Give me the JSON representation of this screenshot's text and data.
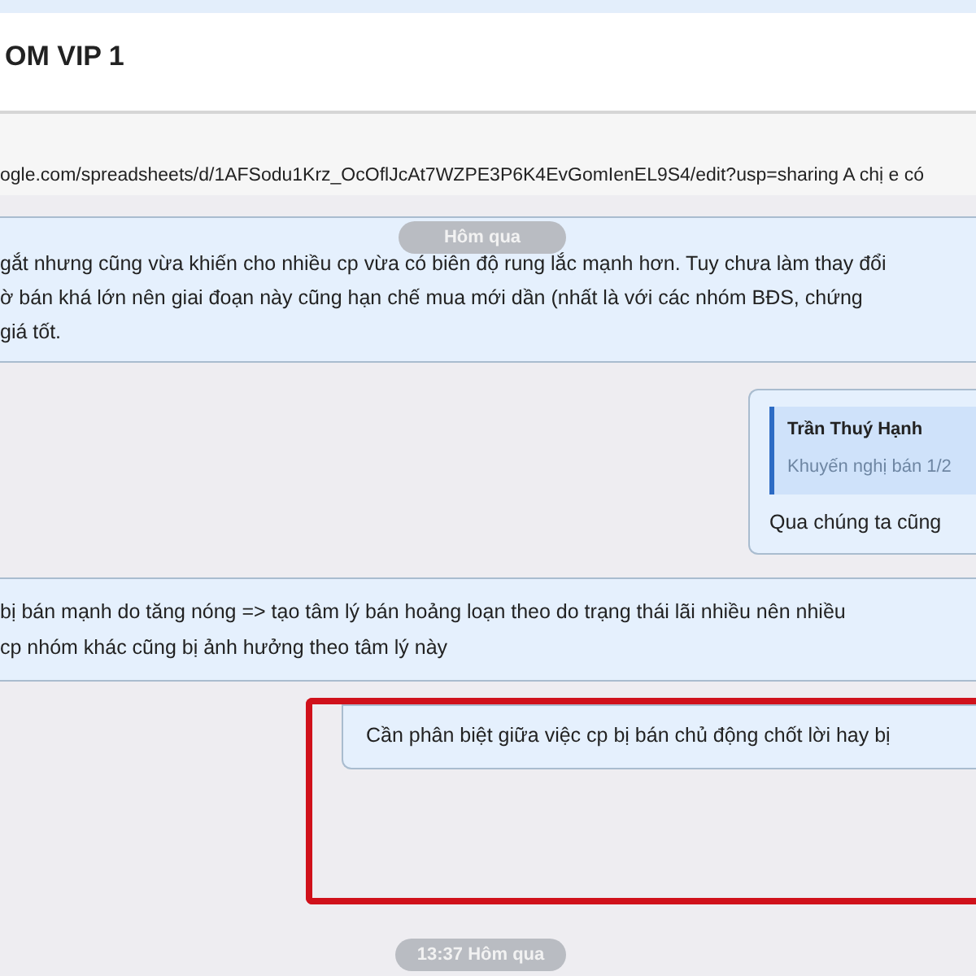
{
  "header": {
    "title": "OM VIP 1"
  },
  "shared_link": "ogle.com/spreadsheets/d/1AFSodu1Krz_OcOflJcAt7WZPE3P6K4EvGomIenEL9S4/edit?usp=sharing A chị e có",
  "messages": [
    {
      "kind": "text",
      "lines": [
        "gắt nhưng cũng vừa khiến cho nhiều cp vừa có biên độ rung lắc mạnh hơn. Tuy chưa làm thay đổi",
        "ờ bán khá lớn nên giai đoạn này cũng hạn chế mua mới dần (nhất là với các nhóm BĐS, chứng",
        "giá tốt."
      ]
    },
    {
      "kind": "reply",
      "quote_author": "Trần Thuý Hạnh",
      "quote_text": "Khuyến nghị bán 1/2",
      "lines": [
        "Qua chúng ta cũng"
      ]
    },
    {
      "kind": "text",
      "lines": [
        "bị bán mạnh do tăng nóng => tạo tâm lý bán hoảng loạn theo do trạng thái lãi nhiều nên nhiều",
        "cp nhóm khác cũng bị ảnh hưởng theo tâm lý này"
      ]
    },
    {
      "kind": "highlighted",
      "lines": [
        "Cần phân biệt giữa việc cp bị bán chủ động chốt lời hay bị"
      ]
    }
  ],
  "date_pills": [
    "Hôm qua",
    "13:37 Hôm qua"
  ]
}
